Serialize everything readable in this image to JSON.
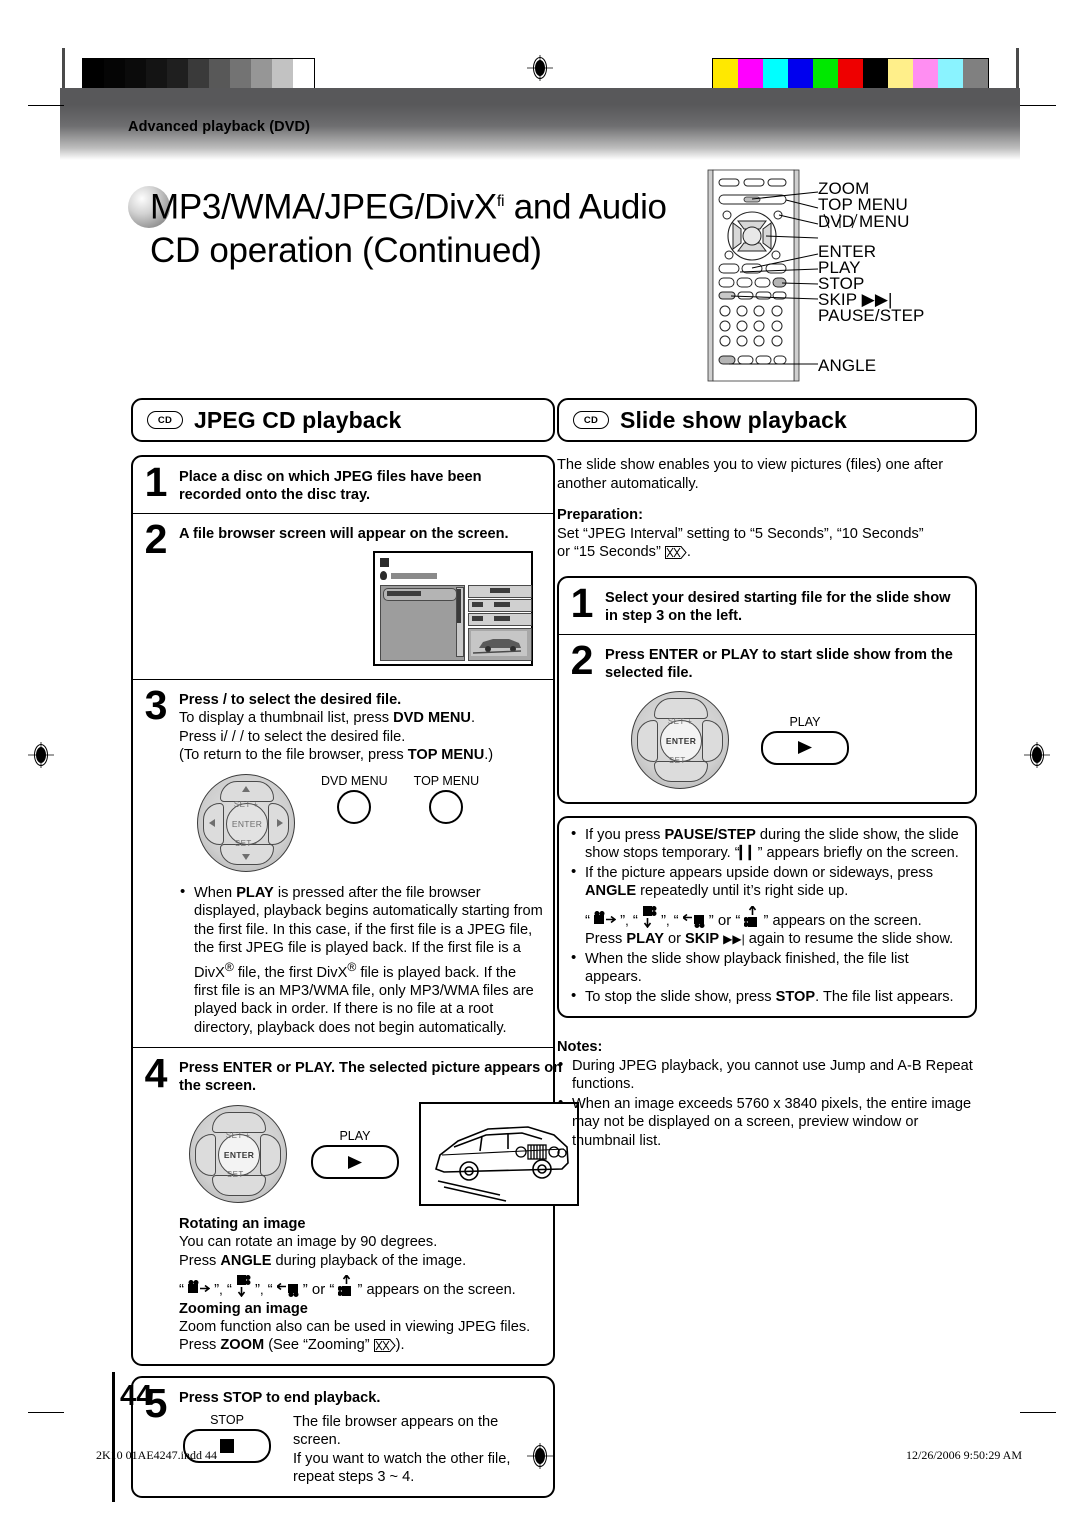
{
  "page": {
    "number": "44",
    "header_tab": "Advanced playback (DVD)",
    "title_line1": "MP3/WMA/JPEG/DivX",
    "title_sup": "fi",
    "title_line1_tail": " and Audio",
    "title_line2": "CD operation (Continued)"
  },
  "footer": {
    "filename": "2K10 01AE4247.indd   44",
    "timestamp": "12/26/2006   9:50:29 AM"
  },
  "colorbars": {
    "gray_steps": [
      "#000000",
      "#050505",
      "#0b0b0b",
      "#141414",
      "#1f1f1f",
      "#3a3a3a",
      "#585858",
      "#737373",
      "#969696",
      "#c2c2c2",
      "#ffffff"
    ],
    "colors": [
      "#ffe800",
      "#ff00ff",
      "#00ffff",
      "#0000ee",
      "#00e800",
      "#ee0000",
      "#000000",
      "#ffef8a",
      "#ff8ef2",
      "#8af3ff",
      "#808080"
    ]
  },
  "remote": {
    "labels": [
      "ZOOM",
      "TOP MENU",
      "DVD MENU",
      "ENTER",
      "PLAY",
      "STOP",
      "SKIP ▶▶|",
      "PAUSE/STEP",
      "ANGLE"
    ]
  },
  "left": {
    "badge": "CD",
    "heading": "JPEG CD playback",
    "steps": [
      {
        "num": "1",
        "bold": "Place a disc on which JPEG files have been recorded onto the disc tray."
      },
      {
        "num": "2",
        "bold": "A file browser screen will appear on the screen."
      },
      {
        "num": "3",
        "bold": "Press    /    to select the desired file.",
        "lines": [
          "To display a thumbnail list, press DVD MENU.",
          "Press  i/  /  /    to select the desired file.",
          "(To return to the file browser, press TOP MENU.)"
        ],
        "button_labels": [
          "DVD MENU",
          "TOP MENU"
        ],
        "bullet": "When PLAY is pressed after the file browser displayed, playback begins automatically starting from the first file. In this case, if the first file is a JPEG file, the first JPEG file is played back. If the first file is a DivX® file, the first DivX® file is played back. If the first file is an MP3/WMA file, only MP3/WMA files are played back in order. If there is no file at a root directory, playback does not begin automatically."
      },
      {
        "num": "4",
        "bold": "Press ENTER or PLAY. The selected picture appears on the screen.",
        "play_label": "PLAY",
        "sub1_head": "Rotating an image",
        "sub1_lines": [
          "You can rotate an image by 90 degrees.",
          "Press ANGLE during playback of the image."
        ],
        "sub1_icons_tail": "” appears on the screen.",
        "sub2_head": "Zooming an image",
        "sub2_lines": [
          "Zoom function also can be used in viewing JPEG files.",
          "Press ZOOM (See “Zooming”      )."
        ]
      },
      {
        "num": "5",
        "bold": "Press STOP to end playback.",
        "stop_label": "STOP",
        "lines": [
          "The file browser appears on the screen.",
          "If you want to watch the other file,",
          "repeat steps 3 ~ 4."
        ]
      }
    ]
  },
  "right": {
    "badge": "CD",
    "heading": "Slide show playback",
    "intro": "The slide show enables you to view pictures (files) one after another automatically.",
    "prep_head": "Preparation:",
    "prep_lines": [
      "Set “JPEG Interval” setting to “5 Seconds”, “10 Seconds”",
      "or “15 Seconds”      ."
    ],
    "steps": [
      {
        "num": "1",
        "bold": "Select your desired starting file for the slide show in step 3 on the left."
      },
      {
        "num": "2",
        "bold": "Press ENTER or PLAY to start slide show from the selected file.",
        "play_label": "PLAY"
      }
    ],
    "bullets": [
      "If you press PAUSE/STEP during the slide show, the slide show stops temporary. “ ❚❚ ” appears briefly on the screen.",
      "If the picture appears upside down or sideways, press ANGLE repeatedly until it’s right side up.",
      "When the slide show playback finished, the file list appears.",
      "To stop the slide show, press STOP. The file list appears."
    ],
    "angle_tail": "” appears on the screen.",
    "resume_line": "Press PLAY or SKIP ▶▶| again to resume the slide show.",
    "notes_head": "Notes:",
    "notes": [
      "During JPEG playback, you cannot use Jump and A-B Repeat functions.",
      "When an image exceeds 5760 x 3840 pixels, the entire image may not be displayed on a screen, preview window or thumbnail list."
    ]
  }
}
